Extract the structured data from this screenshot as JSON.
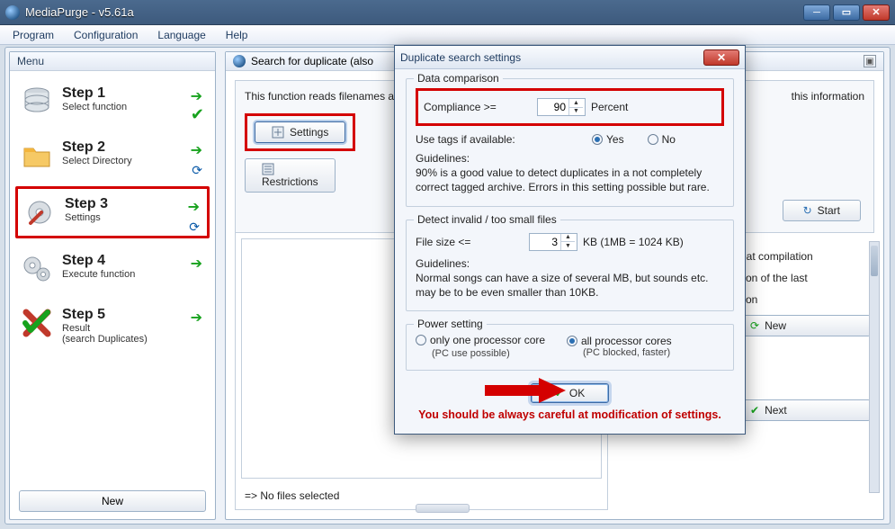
{
  "window": {
    "title": "MediaPurge - v5.61a",
    "min_label": "_",
    "max_label": "▢",
    "close_label": "×"
  },
  "menubar": {
    "program": "Program",
    "configuration": "Configuration",
    "language": "Language",
    "help": "Help"
  },
  "sidebar": {
    "title": "Menu",
    "new_button": "New",
    "steps": [
      {
        "title": "Step 1",
        "subtitle": "Select function"
      },
      {
        "title": "Step 2",
        "subtitle": "Select Directory"
      },
      {
        "title": "Step 3",
        "subtitle": "Settings"
      },
      {
        "title": "Step 4",
        "subtitle": "Execute function"
      },
      {
        "title": "Step 5",
        "subtitle": "Result\n(search Duplicates)"
      }
    ]
  },
  "main": {
    "header": "Search for duplicate (also",
    "description": "This function reads filenames and looks for duplicate files",
    "extra_text": "this information",
    "settings_button": "Settings",
    "restrictions_button": "Restrictions",
    "start_button": "Start",
    "file_status": "=> No files selected",
    "side": {
      "compilation_hint": "eat compilation",
      "last_hint_a": "tion of the last",
      "last_hint_b": "tion",
      "new_button": "New",
      "next_button": "Next"
    }
  },
  "dialog": {
    "title": "Duplicate search settings",
    "close": "×",
    "data_comparison": {
      "legend": "Data comparison",
      "compliance_label": "Compliance >=",
      "compliance_value": "90",
      "compliance_unit": "Percent",
      "use_tags_label": "Use tags if available:",
      "yes": "Yes",
      "no": "No",
      "guidelines_label": "Guidelines:",
      "guidelines_text": "90% is a good value to detect duplicates in a not completely correct tagged archive. Errors in this setting possible but rare."
    },
    "detect_invalid": {
      "legend": "Detect invalid / too small files",
      "size_label": "File size <=",
      "size_value": "3",
      "size_unit": "KB (1MB = 1024 KB)",
      "guidelines_label": "Guidelines:",
      "guidelines_text": "Normal songs can have a size of several MB, but sounds etc. may be to be even smaller than 10KB."
    },
    "power": {
      "legend": "Power setting",
      "one_core": "only one processor core",
      "one_core_sub": "(PC use possible)",
      "all_cores": "all processor cores",
      "all_cores_sub": "(PC blocked, faster)"
    },
    "ok": "OK",
    "warning": "You should be always careful at modification of settings."
  }
}
